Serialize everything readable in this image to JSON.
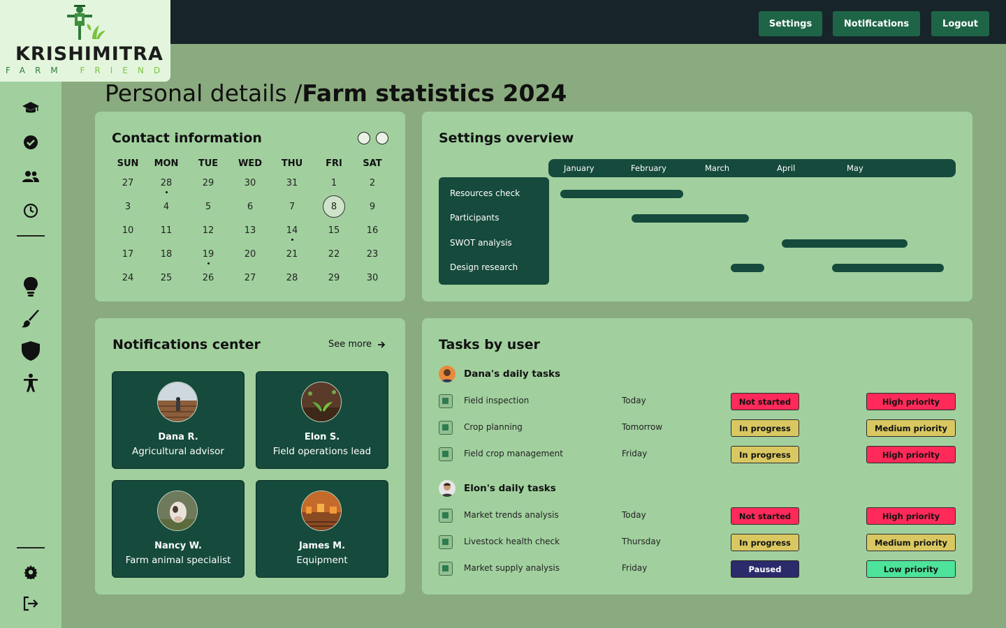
{
  "brand": {
    "name": "KRISHIMITRA",
    "tagline_a": "FARM",
    "tagline_b": "FRIEND",
    "logo_icon": "scarecrow-icon"
  },
  "topbar": {
    "settings_label": "Settings",
    "notifications_label": "Notifications",
    "logout_label": "Logout"
  },
  "sidebar": {
    "top_icons": [
      "graduation-cap-icon",
      "check-circle-icon",
      "users-icon",
      "clock-icon"
    ],
    "mid_icons": [
      "lightbulb-icon",
      "brush-icon",
      "shield-icon",
      "accessibility-icon"
    ],
    "bottom_icons": [
      "gear-icon",
      "logout-icon"
    ]
  },
  "page": {
    "title_prefix": "Personal details /",
    "title_main": "Farm statistics 2024"
  },
  "calendar": {
    "title": "Contact information",
    "weekdays": [
      "SUN",
      "MON",
      "TUE",
      "WED",
      "THU",
      "FRI",
      "SAT"
    ],
    "weeks": [
      [
        "27",
        "28",
        "29",
        "30",
        "31",
        "1",
        "2"
      ],
      [
        "3",
        "4",
        "5",
        "6",
        "7",
        "8",
        "9"
      ],
      [
        "10",
        "11",
        "12",
        "13",
        "14",
        "15",
        "16"
      ],
      [
        "17",
        "18",
        "19",
        "20",
        "21",
        "22",
        "23"
      ],
      [
        "24",
        "25",
        "26",
        "27",
        "28",
        "29",
        "30"
      ]
    ],
    "selected": "8",
    "dots": [
      "28",
      "14",
      "19"
    ]
  },
  "gantt": {
    "title": "Settings overview",
    "months": [
      "January",
      "February",
      "March",
      "April",
      "May"
    ],
    "rows": [
      "Resources check",
      "Participants",
      "SWOT analysis",
      "Design research"
    ]
  },
  "notifications": {
    "title": "Notifications center",
    "see_more": "See more",
    "people": [
      {
        "name": "Dana R.",
        "role": "Agricultural advisor"
      },
      {
        "name": "Elon S.",
        "role": "Field operations lead"
      },
      {
        "name": "Nancy W.",
        "role": "Farm animal specialist"
      },
      {
        "name": "James M.",
        "role": "Equipment"
      }
    ]
  },
  "tasks": {
    "title": "Tasks by user",
    "groups": [
      {
        "user": "Dana's daily tasks",
        "items": [
          {
            "task": "Field inspection",
            "due": "Today",
            "status": "Not started",
            "priority": "High priority"
          },
          {
            "task": "Crop planning",
            "due": "Tomorrow",
            "status": "In progress",
            "priority": "Medium priority"
          },
          {
            "task": "Field crop management",
            "due": "Friday",
            "status": "In progress",
            "priority": "High priority"
          }
        ]
      },
      {
        "user": "Elon's daily tasks",
        "items": [
          {
            "task": "Market trends analysis",
            "due": "Today",
            "status": "Not started",
            "priority": "High priority"
          },
          {
            "task": "Livestock health check",
            "due": "Thursday",
            "status": "In progress",
            "priority": "Medium priority"
          },
          {
            "task": "Market supply analysis",
            "due": "Friday",
            "status": "Paused",
            "priority": "Low priority"
          }
        ]
      }
    ]
  },
  "colors": {
    "not_started": "#ff2a5a",
    "in_progress": "#d9c861",
    "high": "#ff2a5a",
    "medium": "#d9c861",
    "paused": "#2b2a6b",
    "low": "#4de39a",
    "dark_green": "#154a3c",
    "card": "#a1d09e"
  }
}
